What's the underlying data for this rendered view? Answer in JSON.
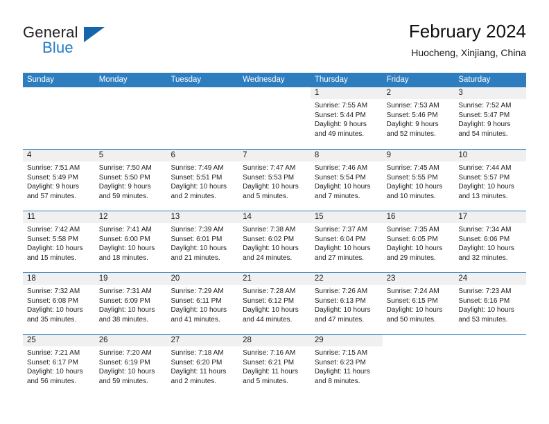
{
  "brand": {
    "name_top": "General",
    "name_bottom": "Blue",
    "accent_color": "#1565ad",
    "text_color": "#231f20"
  },
  "header": {
    "title": "February 2024",
    "subtitle": "Huocheng, Xinjiang, China"
  },
  "calendar": {
    "header_bg": "#2e7ebf",
    "row_divider_color": "#2e7ebf",
    "daynum_band_bg": "#f0f0f0",
    "weekdays": [
      "Sunday",
      "Monday",
      "Tuesday",
      "Wednesday",
      "Thursday",
      "Friday",
      "Saturday"
    ],
    "weeks": [
      [
        {
          "day": "",
          "blank": true,
          "sunrise": "",
          "sunset": "",
          "daylight_line1": "",
          "daylight_line2": ""
        },
        {
          "day": "",
          "blank": true,
          "sunrise": "",
          "sunset": "",
          "daylight_line1": "",
          "daylight_line2": ""
        },
        {
          "day": "",
          "blank": true,
          "sunrise": "",
          "sunset": "",
          "daylight_line1": "",
          "daylight_line2": ""
        },
        {
          "day": "",
          "blank": true,
          "sunrise": "",
          "sunset": "",
          "daylight_line1": "",
          "daylight_line2": ""
        },
        {
          "day": "1",
          "sunrise": "Sunrise: 7:55 AM",
          "sunset": "Sunset: 5:44 PM",
          "daylight_line1": "Daylight: 9 hours",
          "daylight_line2": "and 49 minutes."
        },
        {
          "day": "2",
          "sunrise": "Sunrise: 7:53 AM",
          "sunset": "Sunset: 5:46 PM",
          "daylight_line1": "Daylight: 9 hours",
          "daylight_line2": "and 52 minutes."
        },
        {
          "day": "3",
          "sunrise": "Sunrise: 7:52 AM",
          "sunset": "Sunset: 5:47 PM",
          "daylight_line1": "Daylight: 9 hours",
          "daylight_line2": "and 54 minutes."
        }
      ],
      [
        {
          "day": "4",
          "sunrise": "Sunrise: 7:51 AM",
          "sunset": "Sunset: 5:49 PM",
          "daylight_line1": "Daylight: 9 hours",
          "daylight_line2": "and 57 minutes."
        },
        {
          "day": "5",
          "sunrise": "Sunrise: 7:50 AM",
          "sunset": "Sunset: 5:50 PM",
          "daylight_line1": "Daylight: 9 hours",
          "daylight_line2": "and 59 minutes."
        },
        {
          "day": "6",
          "sunrise": "Sunrise: 7:49 AM",
          "sunset": "Sunset: 5:51 PM",
          "daylight_line1": "Daylight: 10 hours",
          "daylight_line2": "and 2 minutes."
        },
        {
          "day": "7",
          "sunrise": "Sunrise: 7:47 AM",
          "sunset": "Sunset: 5:53 PM",
          "daylight_line1": "Daylight: 10 hours",
          "daylight_line2": "and 5 minutes."
        },
        {
          "day": "8",
          "sunrise": "Sunrise: 7:46 AM",
          "sunset": "Sunset: 5:54 PM",
          "daylight_line1": "Daylight: 10 hours",
          "daylight_line2": "and 7 minutes."
        },
        {
          "day": "9",
          "sunrise": "Sunrise: 7:45 AM",
          "sunset": "Sunset: 5:55 PM",
          "daylight_line1": "Daylight: 10 hours",
          "daylight_line2": "and 10 minutes."
        },
        {
          "day": "10",
          "sunrise": "Sunrise: 7:44 AM",
          "sunset": "Sunset: 5:57 PM",
          "daylight_line1": "Daylight: 10 hours",
          "daylight_line2": "and 13 minutes."
        }
      ],
      [
        {
          "day": "11",
          "sunrise": "Sunrise: 7:42 AM",
          "sunset": "Sunset: 5:58 PM",
          "daylight_line1": "Daylight: 10 hours",
          "daylight_line2": "and 15 minutes."
        },
        {
          "day": "12",
          "sunrise": "Sunrise: 7:41 AM",
          "sunset": "Sunset: 6:00 PM",
          "daylight_line1": "Daylight: 10 hours",
          "daylight_line2": "and 18 minutes."
        },
        {
          "day": "13",
          "sunrise": "Sunrise: 7:39 AM",
          "sunset": "Sunset: 6:01 PM",
          "daylight_line1": "Daylight: 10 hours",
          "daylight_line2": "and 21 minutes."
        },
        {
          "day": "14",
          "sunrise": "Sunrise: 7:38 AM",
          "sunset": "Sunset: 6:02 PM",
          "daylight_line1": "Daylight: 10 hours",
          "daylight_line2": "and 24 minutes."
        },
        {
          "day": "15",
          "sunrise": "Sunrise: 7:37 AM",
          "sunset": "Sunset: 6:04 PM",
          "daylight_line1": "Daylight: 10 hours",
          "daylight_line2": "and 27 minutes."
        },
        {
          "day": "16",
          "sunrise": "Sunrise: 7:35 AM",
          "sunset": "Sunset: 6:05 PM",
          "daylight_line1": "Daylight: 10 hours",
          "daylight_line2": "and 29 minutes."
        },
        {
          "day": "17",
          "sunrise": "Sunrise: 7:34 AM",
          "sunset": "Sunset: 6:06 PM",
          "daylight_line1": "Daylight: 10 hours",
          "daylight_line2": "and 32 minutes."
        }
      ],
      [
        {
          "day": "18",
          "sunrise": "Sunrise: 7:32 AM",
          "sunset": "Sunset: 6:08 PM",
          "daylight_line1": "Daylight: 10 hours",
          "daylight_line2": "and 35 minutes."
        },
        {
          "day": "19",
          "sunrise": "Sunrise: 7:31 AM",
          "sunset": "Sunset: 6:09 PM",
          "daylight_line1": "Daylight: 10 hours",
          "daylight_line2": "and 38 minutes."
        },
        {
          "day": "20",
          "sunrise": "Sunrise: 7:29 AM",
          "sunset": "Sunset: 6:11 PM",
          "daylight_line1": "Daylight: 10 hours",
          "daylight_line2": "and 41 minutes."
        },
        {
          "day": "21",
          "sunrise": "Sunrise: 7:28 AM",
          "sunset": "Sunset: 6:12 PM",
          "daylight_line1": "Daylight: 10 hours",
          "daylight_line2": "and 44 minutes."
        },
        {
          "day": "22",
          "sunrise": "Sunrise: 7:26 AM",
          "sunset": "Sunset: 6:13 PM",
          "daylight_line1": "Daylight: 10 hours",
          "daylight_line2": "and 47 minutes."
        },
        {
          "day": "23",
          "sunrise": "Sunrise: 7:24 AM",
          "sunset": "Sunset: 6:15 PM",
          "daylight_line1": "Daylight: 10 hours",
          "daylight_line2": "and 50 minutes."
        },
        {
          "day": "24",
          "sunrise": "Sunrise: 7:23 AM",
          "sunset": "Sunset: 6:16 PM",
          "daylight_line1": "Daylight: 10 hours",
          "daylight_line2": "and 53 minutes."
        }
      ],
      [
        {
          "day": "25",
          "sunrise": "Sunrise: 7:21 AM",
          "sunset": "Sunset: 6:17 PM",
          "daylight_line1": "Daylight: 10 hours",
          "daylight_line2": "and 56 minutes."
        },
        {
          "day": "26",
          "sunrise": "Sunrise: 7:20 AM",
          "sunset": "Sunset: 6:19 PM",
          "daylight_line1": "Daylight: 10 hours",
          "daylight_line2": "and 59 minutes."
        },
        {
          "day": "27",
          "sunrise": "Sunrise: 7:18 AM",
          "sunset": "Sunset: 6:20 PM",
          "daylight_line1": "Daylight: 11 hours",
          "daylight_line2": "and 2 minutes."
        },
        {
          "day": "28",
          "sunrise": "Sunrise: 7:16 AM",
          "sunset": "Sunset: 6:21 PM",
          "daylight_line1": "Daylight: 11 hours",
          "daylight_line2": "and 5 minutes."
        },
        {
          "day": "29",
          "sunrise": "Sunrise: 7:15 AM",
          "sunset": "Sunset: 6:23 PM",
          "daylight_line1": "Daylight: 11 hours",
          "daylight_line2": "and 8 minutes."
        },
        {
          "day": "",
          "blank": true,
          "sunrise": "",
          "sunset": "",
          "daylight_line1": "",
          "daylight_line2": ""
        },
        {
          "day": "",
          "blank": true,
          "sunrise": "",
          "sunset": "",
          "daylight_line1": "",
          "daylight_line2": ""
        }
      ]
    ]
  }
}
